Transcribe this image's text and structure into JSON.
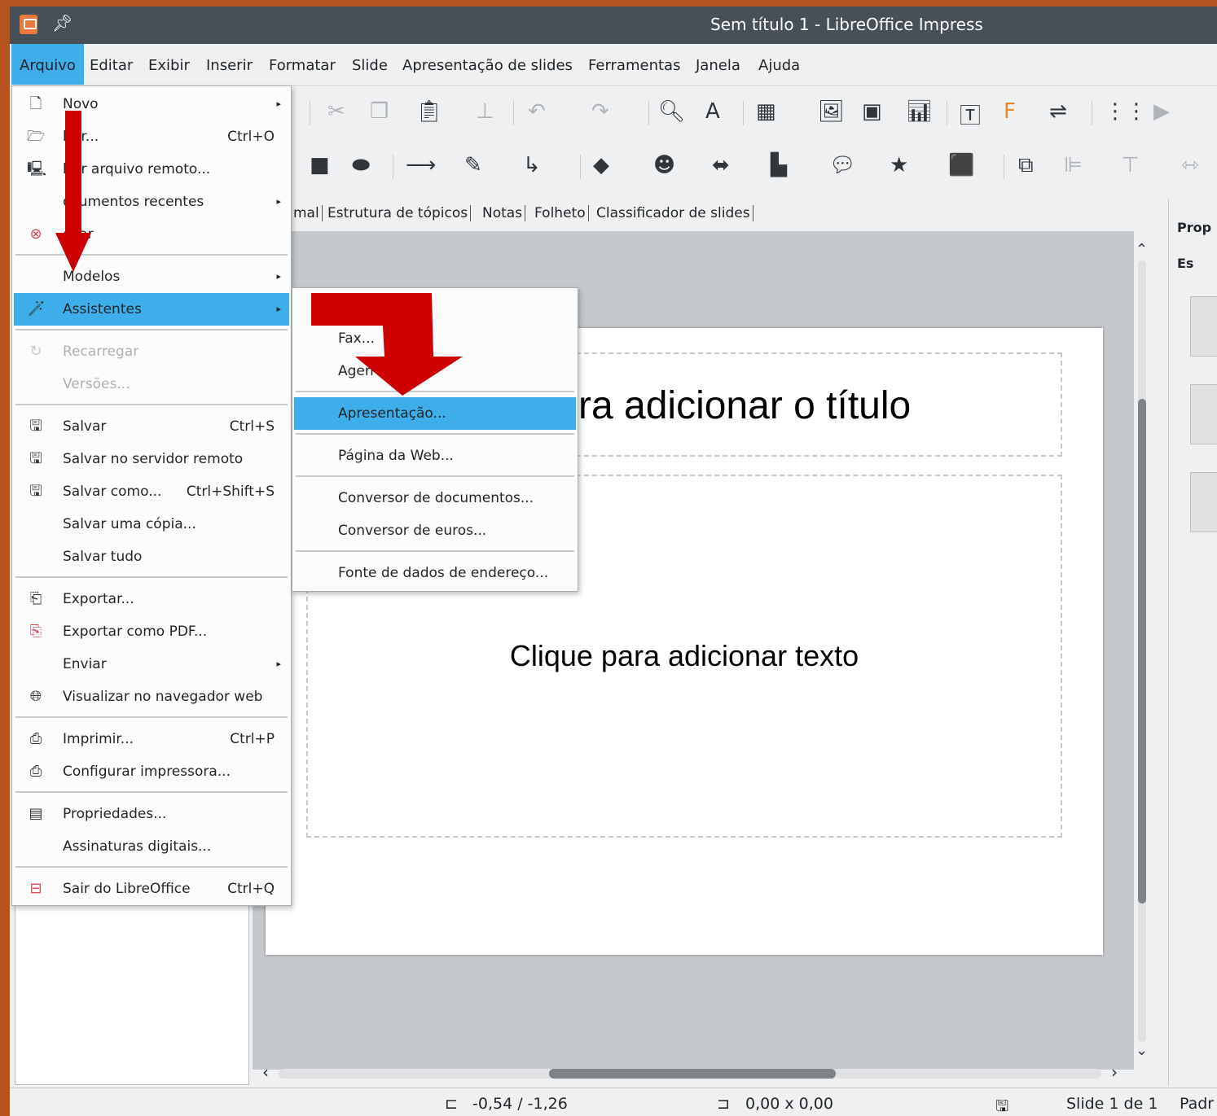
{
  "window": {
    "title": "Sem título 1 - LibreOffice Impress"
  },
  "menubar": [
    "Arquivo",
    "Editar",
    "Exibir",
    "Inserir",
    "Formatar",
    "Slide",
    "Apresentação de slides",
    "Ferramentas",
    "Janela",
    "Ajuda"
  ],
  "view_tabs": [
    "mal",
    "Estrutura de tópicos",
    "Notas",
    "Folheto",
    "Classificador de slides"
  ],
  "file_menu": {
    "novo": "Novo",
    "abrir": "brir...",
    "abrir_sc": "Ctrl+O",
    "abrir_remoto": "brir arquivo remoto...",
    "recentes": "ocumentos recentes",
    "fechar": "char",
    "modelos": "Modelos",
    "assistentes": "Assistentes",
    "recarregar": "Recarregar",
    "versoes": "Versões...",
    "salvar": "Salvar",
    "salvar_sc": "Ctrl+S",
    "salvar_remoto": "Salvar no servidor remoto",
    "salvar_como": "Salvar como...",
    "salvar_como_sc": "Ctrl+Shift+S",
    "salvar_copia": "Salvar uma cópia...",
    "salvar_tudo": "Salvar tudo",
    "exportar": "Exportar...",
    "exportar_pdf": "Exportar como PDF...",
    "enviar": "Enviar",
    "visualizar_web": "Visualizar no navegador web",
    "imprimir": "Imprimir...",
    "imprimir_sc": "Ctrl+P",
    "config_impressora": "Configurar impressora...",
    "propriedades": "Propriedades...",
    "assinaturas": "Assinaturas digitais...",
    "sair": "Sair do LibreOffice",
    "sair_sc": "Ctrl+Q"
  },
  "wizards_menu": {
    "fax": "Fax...",
    "agenda": "Agen",
    "apresentacao": "Apresentação...",
    "pagina_web": "Página da Web...",
    "conversor_docs": "Conversor de documentos...",
    "conversor_euros": "Conversor de euros...",
    "fonte_dados": "Fonte de dados de endereço..."
  },
  "slide": {
    "title_placeholder": "ra adicionar o título",
    "text_placeholder": "Clique para adicionar texto"
  },
  "sidebar": {
    "header": "Prop",
    "section": "Es"
  },
  "status": {
    "position": "-0,54 / -1,26",
    "size": "0,00 x 0,00",
    "slide": "Slide 1 de 1",
    "master": "Padr"
  },
  "colors": {
    "highlight": "#3daee9",
    "titlebar": "#475057",
    "annotation_arrow": "#cc0000"
  }
}
